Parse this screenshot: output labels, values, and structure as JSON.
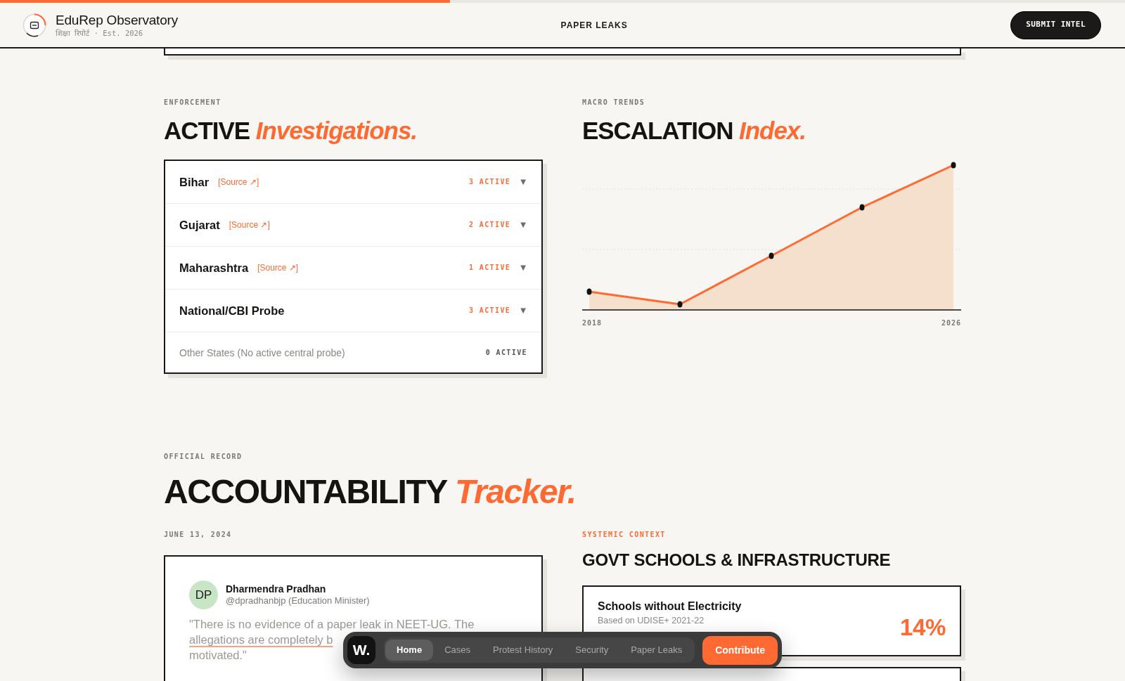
{
  "progress": {
    "level": 0.4
  },
  "header": {
    "brand": "EduRep Observatory",
    "tagline": "शिक्षा रिपोर्ट · Est. 2026",
    "section_link": "PAPER LEAKS",
    "cta": "SUBMIT INTEL"
  },
  "investigations": {
    "eyebrow": "ENFORCEMENT",
    "title": "ACTIVE",
    "title_accent": "Investigations.",
    "rows": [
      {
        "kind": "expandable",
        "name": "Bihar",
        "source": "[Source ↗]",
        "count": "3 ACTIVE",
        "toggle": "▼",
        "expanded": false
      },
      {
        "kind": "expandable",
        "name": "Gujarat",
        "source": "[Source ↗]",
        "count": "2 ACTIVE",
        "toggle": "▼",
        "expanded": false
      },
      {
        "kind": "expandable",
        "name": "Maharashtra",
        "source": "[Source ↗]",
        "count": "1 ACTIVE",
        "toggle": "▼",
        "expanded": false
      },
      {
        "kind": "expandable",
        "name": "National/CBI Probe",
        "count": "3 ACTIVE",
        "toggle": "▼",
        "expanded": false
      },
      {
        "kind": "summary",
        "name": "Other States (No active central probe)",
        "count": "0 ACTIVE"
      }
    ]
  },
  "escalation": {
    "eyebrow": "MACRO TRENDS",
    "title": "ESCALATION",
    "title_accent": "Index.",
    "axis_start": "2018",
    "axis_end": "2026"
  },
  "accountability": {
    "eyebrow": "OFFICIAL RECORD",
    "title": "ACCOUNTABILITY",
    "title_accent": "Tracker.",
    "statement": {
      "date": "JUNE 13, 2024",
      "initials": "DP",
      "author": "Dharmendra Pradhan",
      "handle": "@dpradhanbjp (Education Minister)",
      "quote_lines": [
        {
          "text": "\"There is no evidence of a paper leak in NEET-UG. The",
          "marked": false
        },
        {
          "text": "allegations are completely b",
          "marked": true
        },
        {
          "text": "motivated.\"",
          "marked": false
        }
      ]
    },
    "context": {
      "eyebrow": "SYSTEMIC CONTEXT",
      "title": "GOVT SCHOOLS & INFRASTRUCTURE",
      "stats": [
        {
          "label": "Schools without Electricity",
          "source": "Based on UDISE+ 2021-22",
          "value": "14%"
        }
      ]
    }
  },
  "dock": {
    "logo": "W.",
    "tabs": [
      {
        "label": "Home",
        "selected": true
      },
      {
        "label": "Cases",
        "selected": false
      },
      {
        "label": "Protest History",
        "selected": false
      },
      {
        "label": "Security",
        "selected": false
      },
      {
        "label": "Paper Leaks",
        "selected": false
      }
    ],
    "action": "Contribute"
  }
}
